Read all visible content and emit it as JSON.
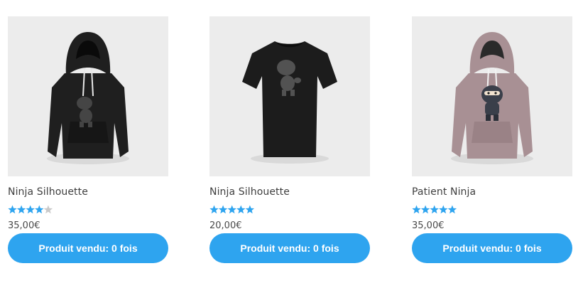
{
  "accent_color": "#2ea4ef",
  "star_filled_color": "#2ea4ef",
  "star_empty_color": "#c9c9c9",
  "products": [
    {
      "name": "Ninja Silhouette",
      "garment": "hoodie",
      "garment_color": "#1f1f1f",
      "rating": 4,
      "rating_max": 5,
      "price": "35,00€",
      "button_label": "Produit vendu: 0 fois"
    },
    {
      "name": "Ninja Silhouette",
      "garment": "t-shirt",
      "garment_color": "#1c1c1c",
      "rating": 5,
      "rating_max": 5,
      "price": "20,00€",
      "button_label": "Produit vendu: 0 fois"
    },
    {
      "name": "Patient Ninja",
      "garment": "hoodie",
      "garment_color": "#a89094",
      "rating": 5,
      "rating_max": 5,
      "price": "35,00€",
      "button_label": "Produit vendu: 0 fois"
    }
  ]
}
